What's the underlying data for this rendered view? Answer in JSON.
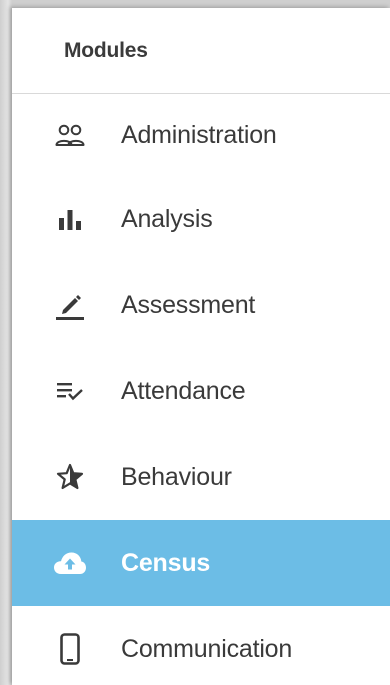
{
  "panel": {
    "title": "Modules"
  },
  "menu": {
    "items": [
      {
        "label": "Administration",
        "icon": "people-icon",
        "active": false
      },
      {
        "label": "Analysis",
        "icon": "bar-chart-icon",
        "active": false
      },
      {
        "label": "Assessment",
        "icon": "pen-icon",
        "active": false
      },
      {
        "label": "Attendance",
        "icon": "list-check-icon",
        "active": false
      },
      {
        "label": "Behaviour",
        "icon": "star-icon",
        "active": false
      },
      {
        "label": "Census",
        "icon": "cloud-upload-icon",
        "active": true
      },
      {
        "label": "Communication",
        "icon": "phone-icon",
        "active": false
      }
    ]
  },
  "colors": {
    "active_background": "#6cbde6",
    "text": "#3a3a3a",
    "active_text": "#ffffff"
  }
}
